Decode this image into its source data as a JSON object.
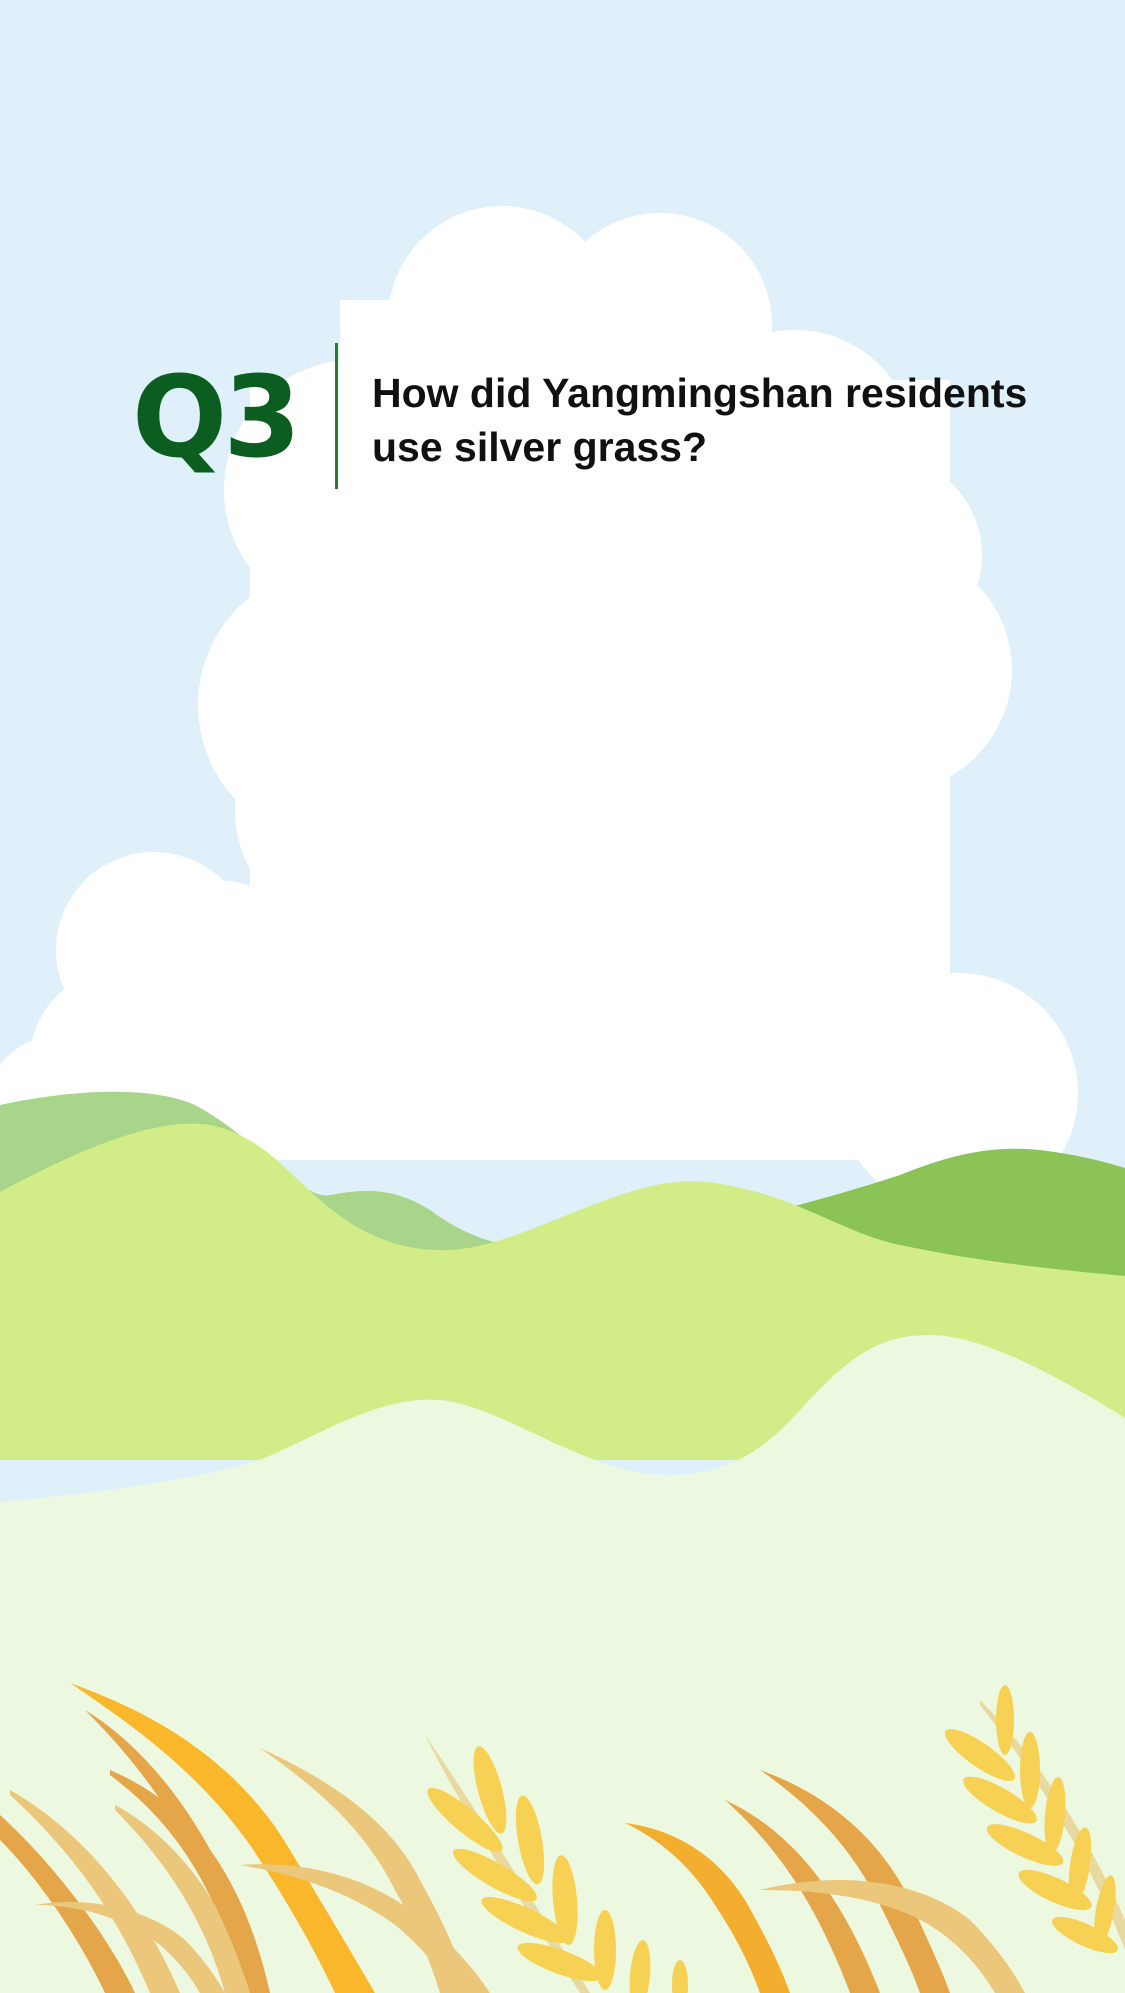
{
  "question": {
    "number": "Q3",
    "text": "How did Yangmingshan residents use silver grass?"
  },
  "colors": {
    "sky": "#dff0fa",
    "cloud": "#ffffff",
    "number": "#0b5e1f",
    "divider": "#2c7a31",
    "hill_light": "#d2ed88",
    "hill_mid": "#a9d58b",
    "hill_dark": "#8cc356",
    "meadow": "#ecf9e0",
    "grass_gold": "#fbb72b",
    "grass_tan": "#eac77a",
    "grass_orange": "#e5a64a",
    "grass_yellow": "#f6d154"
  }
}
